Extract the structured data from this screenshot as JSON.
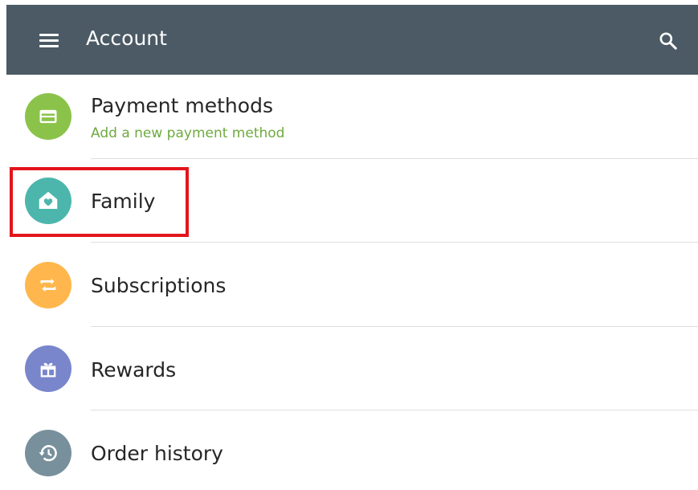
{
  "header": {
    "title": "Account",
    "menu_icon": "menu-icon",
    "search_icon": "search-icon"
  },
  "items": [
    {
      "label": "Payment methods",
      "sublabel": "Add a new payment method",
      "icon": "credit-card-icon",
      "color": "#8bc34a"
    },
    {
      "label": "Family",
      "icon": "family-house-icon",
      "color": "#4db6ac"
    },
    {
      "label": "Subscriptions",
      "icon": "repeat-icon",
      "color": "#ffb74d"
    },
    {
      "label": "Rewards",
      "icon": "gift-icon",
      "color": "#7986cb"
    },
    {
      "label": "Order history",
      "icon": "history-icon",
      "color": "#78909c"
    }
  ],
  "colors": {
    "toolbar": "#4b5a64",
    "sublabel": "#6faa3f",
    "highlight": "#e3151c"
  }
}
